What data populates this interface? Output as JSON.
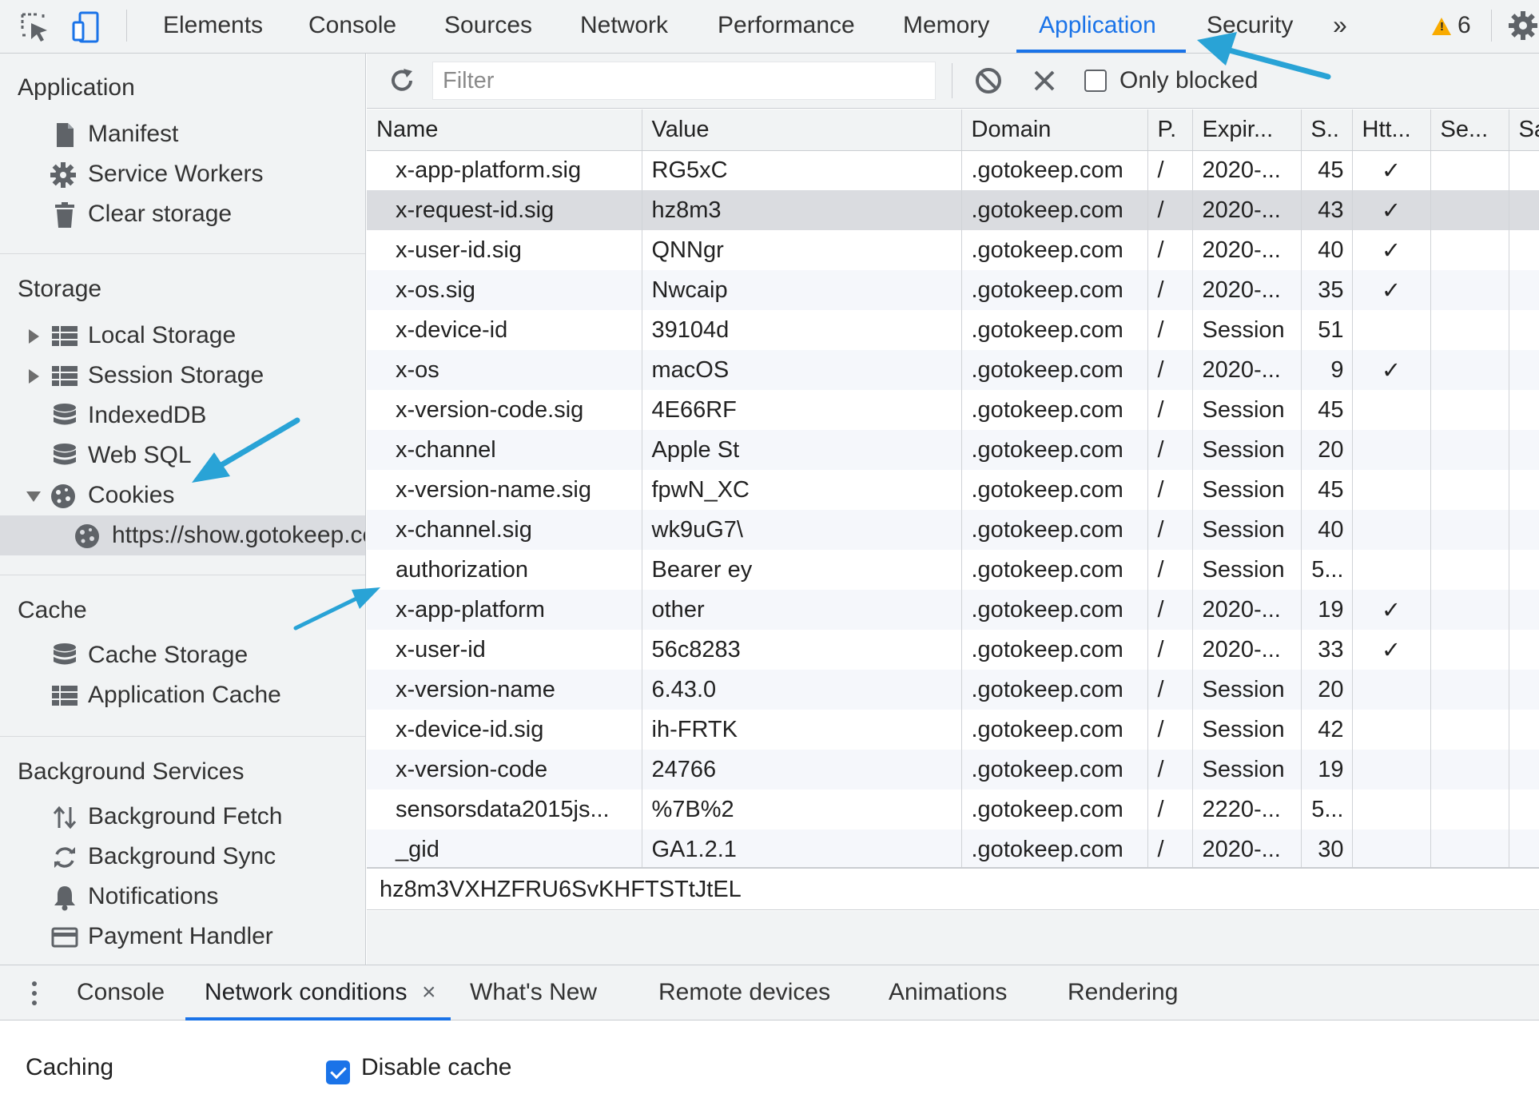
{
  "toolbar": {
    "tabs": [
      "Elements",
      "Console",
      "Sources",
      "Network",
      "Performance",
      "Memory",
      "Application",
      "Security"
    ],
    "more_tabs_glyph": "»",
    "warning_count": "6",
    "warning_glyph": "!"
  },
  "sidebar": {
    "application": {
      "title": "Application",
      "items": [
        "Manifest",
        "Service Workers",
        "Clear storage"
      ]
    },
    "storage": {
      "title": "Storage",
      "items": [
        "Local Storage",
        "Session Storage",
        "IndexedDB",
        "Web SQL",
        "Cookies"
      ],
      "cookie_origin": "https://show.gotokeep.com"
    },
    "cache": {
      "title": "Cache",
      "items": [
        "Cache Storage",
        "Application Cache"
      ]
    },
    "background": {
      "title": "Background Services",
      "items": [
        "Background Fetch",
        "Background Sync",
        "Notifications",
        "Payment Handler"
      ]
    }
  },
  "cookie_toolbar": {
    "filter_placeholder": "Filter",
    "only_blocked_label": "Only blocked"
  },
  "cookies": {
    "columns": [
      "Name",
      "Value",
      "Domain",
      "P.",
      "Expir...",
      "S..",
      "Htt...",
      "Se...",
      "Sa"
    ],
    "check_glyph": "✓",
    "rows": [
      {
        "name": "x-app-platform.sig",
        "value": "RG5xC",
        "domain": ".gotokeep.com",
        "path": "/",
        "expires": "2020-...",
        "size": "45",
        "http": "✓"
      },
      {
        "name": "x-request-id.sig",
        "value": "hz8m3",
        "domain": ".gotokeep.com",
        "path": "/",
        "expires": "2020-...",
        "size": "43",
        "http": "✓"
      },
      {
        "name": "x-user-id.sig",
        "value": "QNNgr",
        "domain": ".gotokeep.com",
        "path": "/",
        "expires": "2020-...",
        "size": "40",
        "http": "✓"
      },
      {
        "name": "x-os.sig",
        "value": "Nwcaip",
        "domain": ".gotokeep.com",
        "path": "/",
        "expires": "2020-...",
        "size": "35",
        "http": "✓"
      },
      {
        "name": "x-device-id",
        "value": "39104d",
        "domain": ".gotokeep.com",
        "path": "/",
        "expires": "Session",
        "size": "51",
        "http": ""
      },
      {
        "name": "x-os",
        "value": "macOS",
        "domain": ".gotokeep.com",
        "path": "/",
        "expires": "2020-...",
        "size": "9",
        "http": "✓"
      },
      {
        "name": "x-version-code.sig",
        "value": "4E66RF",
        "domain": ".gotokeep.com",
        "path": "/",
        "expires": "Session",
        "size": "45",
        "http": ""
      },
      {
        "name": "x-channel",
        "value": "Apple St",
        "domain": ".gotokeep.com",
        "path": "/",
        "expires": "Session",
        "size": "20",
        "http": ""
      },
      {
        "name": "x-version-name.sig",
        "value": "fpwN_XC",
        "domain": ".gotokeep.com",
        "path": "/",
        "expires": "Session",
        "size": "45",
        "http": ""
      },
      {
        "name": "x-channel.sig",
        "value": "wk9uG7\\",
        "domain": ".gotokeep.com",
        "path": "/",
        "expires": "Session",
        "size": "40",
        "http": ""
      },
      {
        "name": "authorization",
        "value": "Bearer ey",
        "domain": ".gotokeep.com",
        "path": "/",
        "expires": "Session",
        "size": "5...",
        "http": ""
      },
      {
        "name": "x-app-platform",
        "value": "other",
        "domain": ".gotokeep.com",
        "path": "/",
        "expires": "2020-...",
        "size": "19",
        "http": "✓"
      },
      {
        "name": "x-user-id",
        "value": "56c8283",
        "domain": ".gotokeep.com",
        "path": "/",
        "expires": "2020-...",
        "size": "33",
        "http": "✓"
      },
      {
        "name": "x-version-name",
        "value": "6.43.0",
        "domain": ".gotokeep.com",
        "path": "/",
        "expires": "Session",
        "size": "20",
        "http": ""
      },
      {
        "name": "x-device-id.sig",
        "value": "ih-FRTK",
        "domain": ".gotokeep.com",
        "path": "/",
        "expires": "Session",
        "size": "42",
        "http": ""
      },
      {
        "name": "x-version-code",
        "value": "24766",
        "domain": ".gotokeep.com",
        "path": "/",
        "expires": "Session",
        "size": "19",
        "http": ""
      },
      {
        "name": "sensorsdata2015js...",
        "value": "%7B%2",
        "domain": ".gotokeep.com",
        "path": "/",
        "expires": "2220-...",
        "size": "5...",
        "http": ""
      },
      {
        "name": "_gid",
        "value": "GA1.2.1",
        "domain": ".gotokeep.com",
        "path": "/",
        "expires": "2020-...",
        "size": "30",
        "http": ""
      }
    ]
  },
  "preview_value": "hz8m3VXHZFRU6SvKHFTSTtJtEL",
  "drawer": {
    "tabs": [
      "Console",
      "Network conditions",
      "What's New",
      "Remote devices",
      "Animations",
      "Rendering"
    ],
    "close_glyph": "×",
    "caching_label": "Caching",
    "disable_cache_label": "Disable cache",
    "disable_cache_checked": true
  },
  "colors": {
    "accent": "#1a73e8",
    "annotation_arrow": "#29a3d6",
    "warning": "#f9ab00",
    "selected_row": "#dadce0"
  }
}
